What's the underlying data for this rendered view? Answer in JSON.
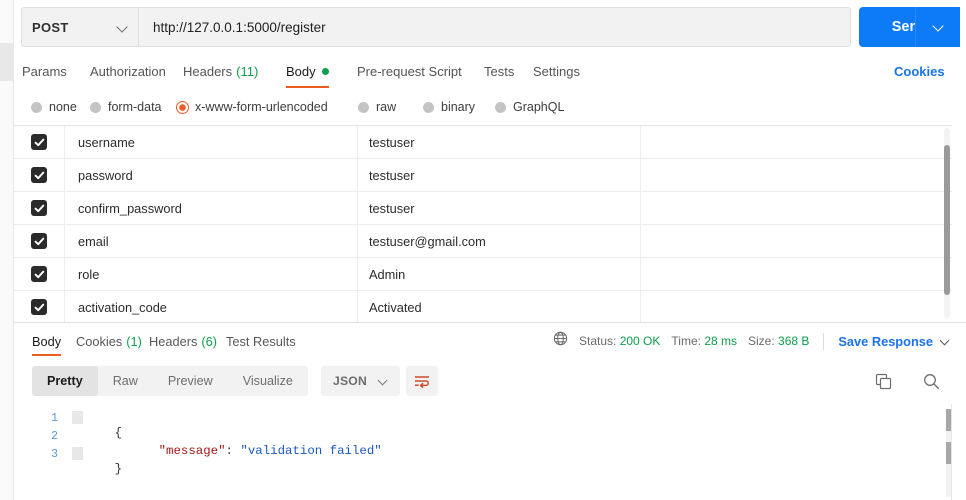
{
  "request": {
    "method": "POST",
    "url": "http://127.0.0.1:5000/register",
    "send_label": "Send",
    "tabs": [
      {
        "label": "Params",
        "count": "",
        "active": false,
        "dot": false
      },
      {
        "label": "Authorization",
        "count": "",
        "active": false,
        "dot": false
      },
      {
        "label": "Headers",
        "count": "(11)",
        "active": false,
        "dot": false
      },
      {
        "label": "Body",
        "count": "",
        "active": true,
        "dot": true
      },
      {
        "label": "Pre-request Script",
        "count": "",
        "active": false,
        "dot": false
      },
      {
        "label": "Tests",
        "count": "",
        "active": false,
        "dot": false
      },
      {
        "label": "Settings",
        "count": "",
        "active": false,
        "dot": false
      }
    ],
    "cookies_link": "Cookies",
    "body_types": [
      {
        "label": "none",
        "selected": false
      },
      {
        "label": "form-data",
        "selected": false
      },
      {
        "label": "x-www-form-urlencoded",
        "selected": true
      },
      {
        "label": "raw",
        "selected": false
      },
      {
        "label": "binary",
        "selected": false
      },
      {
        "label": "GraphQL",
        "selected": false
      }
    ],
    "params": [
      {
        "enabled": true,
        "key": "username",
        "value": "testuser",
        "description": ""
      },
      {
        "enabled": true,
        "key": "password",
        "value": "testuser",
        "description": ""
      },
      {
        "enabled": true,
        "key": "confirm_password",
        "value": "testuser",
        "description": ""
      },
      {
        "enabled": true,
        "key": "email",
        "value": "testuser@gmail.com",
        "description": ""
      },
      {
        "enabled": true,
        "key": "role",
        "value": "Admin",
        "description": ""
      },
      {
        "enabled": true,
        "key": "activation_code",
        "value": "Activated",
        "description": ""
      }
    ]
  },
  "response": {
    "tabs": [
      {
        "label": "Body",
        "count": "",
        "active": true
      },
      {
        "label": "Cookies",
        "count": "(1)",
        "active": false
      },
      {
        "label": "Headers",
        "count": "(6)",
        "active": false
      },
      {
        "label": "Test Results",
        "count": "",
        "active": false
      }
    ],
    "status_label": "Status:",
    "status_value": "200 OK",
    "time_label": "Time:",
    "time_value": "28 ms",
    "size_label": "Size:",
    "size_value": "368 B",
    "save_response": "Save Response",
    "view_modes": [
      {
        "label": "Pretty",
        "active": true
      },
      {
        "label": "Raw",
        "active": false
      },
      {
        "label": "Preview",
        "active": false
      },
      {
        "label": "Visualize",
        "active": false
      }
    ],
    "format": "JSON",
    "body_lines": [
      {
        "num": "1",
        "open_brace": "{",
        "folded": true
      },
      {
        "num": "2",
        "key": "\"message\"",
        "colon": ": ",
        "value": "\"validation failed\"",
        "folded": false
      },
      {
        "num": "3",
        "close_brace": "}",
        "folded": true
      }
    ]
  },
  "colors": {
    "accent": "#ef5b25",
    "link": "#1a73e8",
    "send": "#0d7bf7",
    "success": "#0c9f4b"
  }
}
